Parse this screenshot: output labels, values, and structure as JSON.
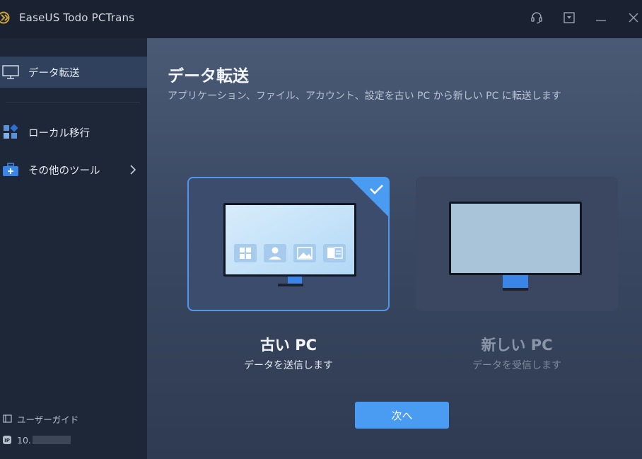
{
  "app": {
    "title": "EaseUS Todo PCTrans"
  },
  "titlebar": {
    "icons": [
      "support-icon",
      "dropdown-menu-icon",
      "minimize-icon",
      "close-icon"
    ]
  },
  "sidebar": {
    "items": [
      {
        "label": "データ転送",
        "icon": "monitor-icon",
        "active": true
      },
      {
        "label": "ローカル移行",
        "icon": "apps-grid-icon",
        "active": false
      },
      {
        "label": "その他のツール",
        "icon": "toolbox-icon",
        "active": false
      }
    ],
    "footer": {
      "guide_label": "ユーザーガイド",
      "ip_prefix": "10."
    }
  },
  "main": {
    "title": "データ転送",
    "subtitle": "アプリケーション、ファイル、アカウント、設定を古い PC から新しい PC に転送します",
    "options": [
      {
        "title": "古い PC",
        "subtitle": "データを送信します",
        "selected": true
      },
      {
        "title": "新しい PC",
        "subtitle": "データを受信します",
        "selected": false
      }
    ],
    "next_label": "次へ"
  },
  "colors": {
    "accent": "#4a9cf2",
    "selected_border": "#4f96ee",
    "sidebar_active": "#30415e"
  }
}
